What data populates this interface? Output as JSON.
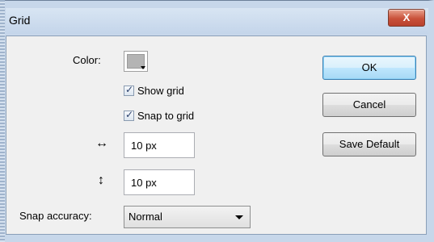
{
  "window": {
    "title": "Grid",
    "close_glyph": "X"
  },
  "form": {
    "color_label": "Color:",
    "color_value": "#b4b4b4",
    "show_grid_label": "Show grid",
    "show_grid_checked": true,
    "snap_to_grid_label": "Snap to grid",
    "snap_to_grid_checked": true,
    "horizontal_icon": "horizontal-arrows-icon",
    "horizontal_value": "10 px",
    "vertical_icon": "vertical-arrows-icon",
    "vertical_value": "10 px",
    "snap_accuracy_label": "Snap accuracy:",
    "snap_accuracy_value": "Normal"
  },
  "buttons": {
    "ok": "OK",
    "cancel": "Cancel",
    "save_default": "Save Default"
  }
}
